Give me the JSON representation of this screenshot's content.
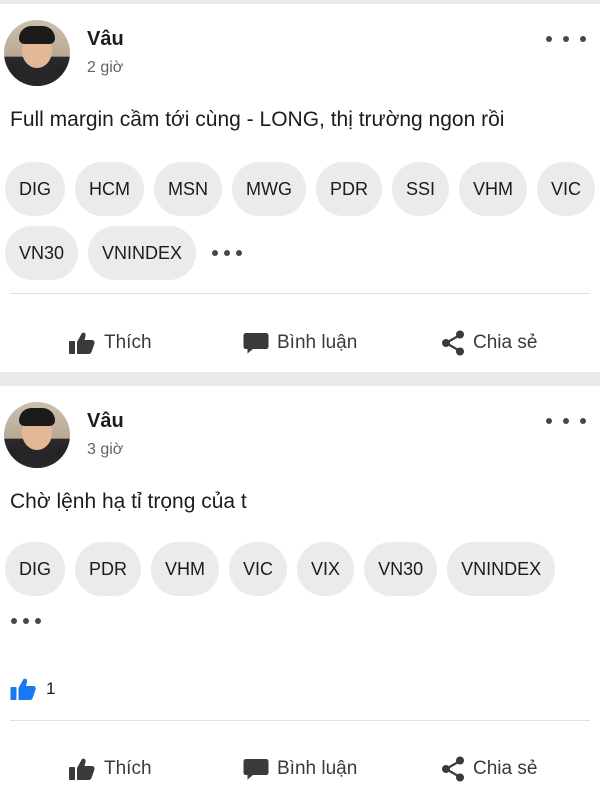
{
  "posts": [
    {
      "author": "Vâu",
      "time": "2 giờ",
      "text": "Full margin cầm tới cùng - LONG, thị trường ngon rồi",
      "tag_rows": [
        [
          "DIG",
          "HCM",
          "MSN",
          "MWG",
          "PDR",
          "SSI",
          "VHM",
          "VIC"
        ],
        [
          "VN30",
          "VNINDEX"
        ]
      ],
      "like_count": null
    },
    {
      "author": "Vâu",
      "time": "3 giờ",
      "text": "Chờ lệnh hạ tỉ trọng của t",
      "tag_rows": [
        [
          "DIG",
          "PDR",
          "VHM",
          "VIC",
          "VIX",
          "VN30",
          "VNINDEX"
        ],
        []
      ],
      "like_count": "1"
    }
  ],
  "actions": {
    "like_label": "Thích",
    "comment_label": "Bình luận",
    "share_label": "Chia sẻ"
  },
  "icons": {
    "like": "thumbs-up-icon",
    "comment": "speech-bubble-icon",
    "share": "share-icon",
    "more": "more-dots-icon",
    "like_badge": "blue-thumbs-up-icon"
  },
  "colors": {
    "background": "#e9e9ea",
    "card": "#ffffff",
    "tag_bg": "#ebebeb",
    "like_blue": "#1877f2",
    "text": "#1c1c1e",
    "muted": "#636366"
  }
}
